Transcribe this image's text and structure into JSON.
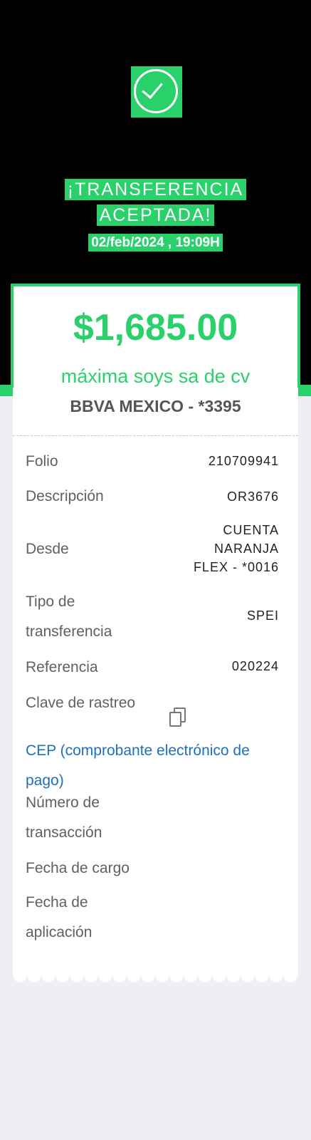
{
  "header": {
    "status_line1": "¡TRANSFERENCIA",
    "status_line2": "ACEPTADA!",
    "datetime": "02/feb/2024 , 19:09H"
  },
  "summary": {
    "amount": "$1,685.00",
    "recipient": "máxima soys sa de cv",
    "bank": "BBVA MEXICO - *3395"
  },
  "details": {
    "folio_label": "Folio",
    "folio_value": "210709941",
    "descripcion_label": "Descripción",
    "descripcion_value": "OR3676",
    "desde_label": "Desde",
    "desde_value_1": "CUENTA",
    "desde_value_2": "NARANJA",
    "desde_value_3": "FLEX - *0016",
    "tipo_label_1": "Tipo de",
    "tipo_label_2": "transferencia",
    "tipo_value": "SPEI",
    "referencia_label": "Referencia",
    "referencia_value": "020224",
    "clave_label": "Clave de rastreo",
    "cep_link": "CEP (comprobante electrónico de pago)",
    "numero_label_1": "Número de",
    "numero_label_2": "transacción",
    "fecha_cargo_label": "Fecha de cargo",
    "fecha_aplicacion_label_1": "Fecha de",
    "fecha_aplicacion_label_2": "aplicación"
  },
  "colors": {
    "accent": "#2ad16b",
    "link": "#1e6fbf",
    "background": "#eeeff3"
  },
  "icons": [
    "check-circle-icon",
    "copy-icon"
  ]
}
